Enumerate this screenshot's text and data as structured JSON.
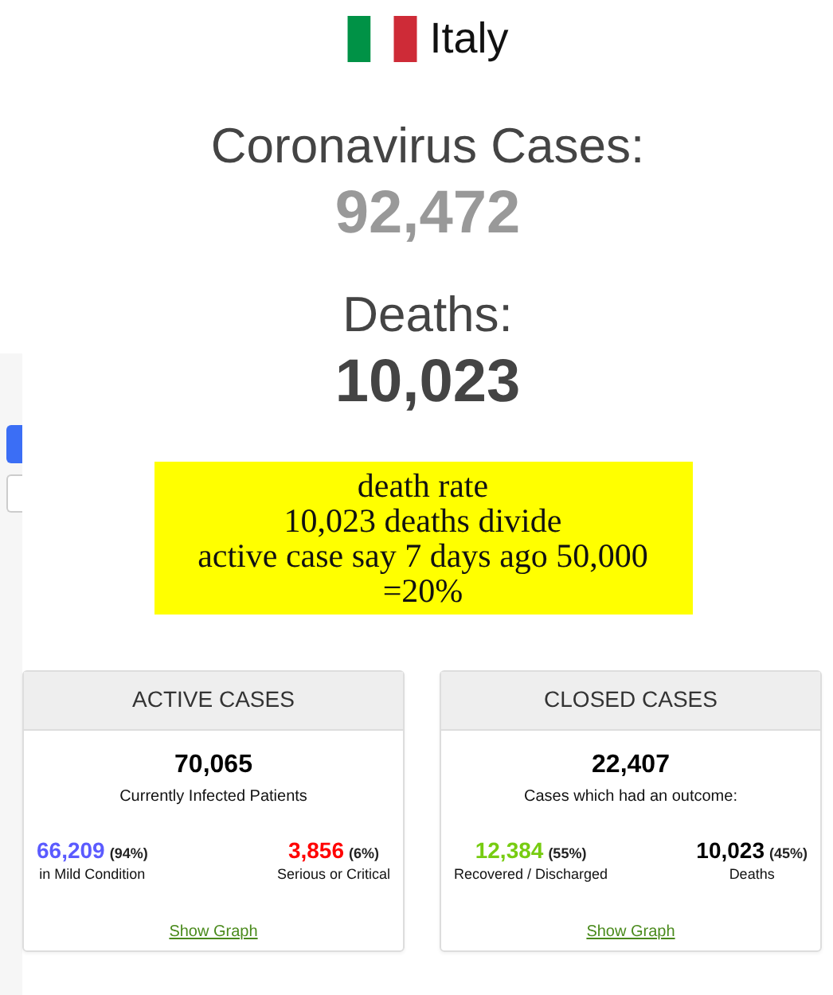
{
  "country": "Italy",
  "cases": {
    "label": "Coronavirus Cases:",
    "value": "92,472"
  },
  "deaths": {
    "label": "Deaths:",
    "value": "10,023"
  },
  "note": [
    "death rate",
    "10,023 deaths divide",
    "active case say 7 days ago 50,000",
    "=20%"
  ],
  "sidebar": {
    "buttons": [
      {
        "selected": true
      },
      {
        "selected": false
      }
    ]
  },
  "cards": [
    {
      "title": "ACTIVE CASES",
      "total": "70,065",
      "caption": "Currently Infected Patients",
      "stats": [
        {
          "value": "66,209",
          "percent": "(94%)",
          "label": "in Mild Condition",
          "color": "#5b5bff"
        },
        {
          "value": "3,856",
          "percent": "(6%)",
          "label": "Serious or Critical",
          "color": "#ff0000"
        }
      ],
      "link": "Show Graph"
    },
    {
      "title": "CLOSED CASES",
      "total": "22,407",
      "caption": "Cases which had an outcome:",
      "stats": [
        {
          "value": "12,384",
          "percent": "(55%)",
          "label": "Recovered / Discharged",
          "color": "#77cc11"
        },
        {
          "value": "10,023",
          "percent": "(45%)",
          "label": "Deaths",
          "color": "#000000"
        }
      ],
      "link": "Show Graph"
    }
  ]
}
